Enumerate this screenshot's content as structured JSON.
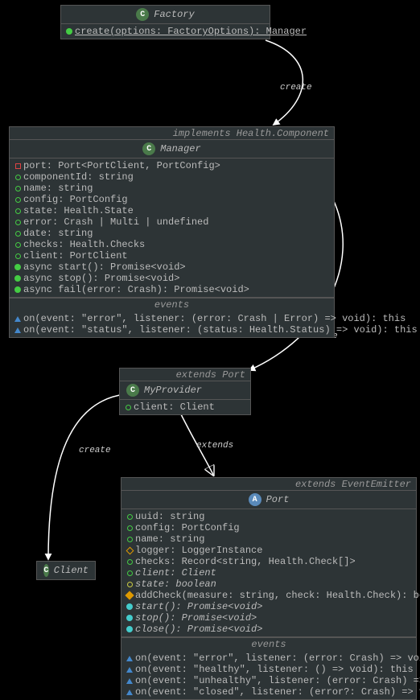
{
  "factory": {
    "title": "Factory",
    "m0": "create(options: FactoryOptions): Manager"
  },
  "manager": {
    "title": "Manager",
    "impl": "implements Health.Component",
    "f0": "port: Port<PortClient, PortConfig>",
    "f1": "componentId: string",
    "f2": "name: string",
    "f3": "config: PortConfig",
    "f4": "state: Health.State",
    "f5": "error: Crash | Multi | undefined",
    "f6": "date: string",
    "f7": "checks: Health.Checks",
    "f8": "client: PortClient",
    "m0": "async start(): Promise<void>",
    "m1": "async stop(): Promise<void>",
    "m2": "async fail(error: Crash): Promise<void>",
    "evh": "events",
    "e0": "on(event: \"error\", listener: (error: Crash | Error) => void): this",
    "e1": "on(event: \"status\", listener: (status: Health.Status) => void): this"
  },
  "myprovider": {
    "title": "MyProvider",
    "ext": "extends Port",
    "f0": "client: Client"
  },
  "client": {
    "title": "Client"
  },
  "port": {
    "title": "Port",
    "ext": "extends EventEmitter",
    "f0": "uuid: string",
    "f1": "config: PortConfig",
    "f2": "name: string",
    "f3": "logger: LoggerInstance",
    "f4": "checks: Record<string, Health.Check[]>",
    "f5": "client: Client",
    "f6": "state: boolean",
    "m0": "addCheck(measure: string, check: Health.Check): boolean",
    "m1": "start(): Promise<void>",
    "m2": "stop(): Promise<void>",
    "m3": "close(): Promise<void>",
    "evh": "events",
    "e0": "on(event: \"error\", listener: (error: Crash) => void): this",
    "e1": "on(event: \"healthy\", listener: () => void): this",
    "e2": "on(event: \"unhealthy\", listener: (error: Crash) => void): this",
    "e3": "on(event: \"closed\", listener: (error?: Crash) => void): this"
  },
  "labels": {
    "create1": "create",
    "create2": "create",
    "create3": "create",
    "extends": "extends"
  }
}
